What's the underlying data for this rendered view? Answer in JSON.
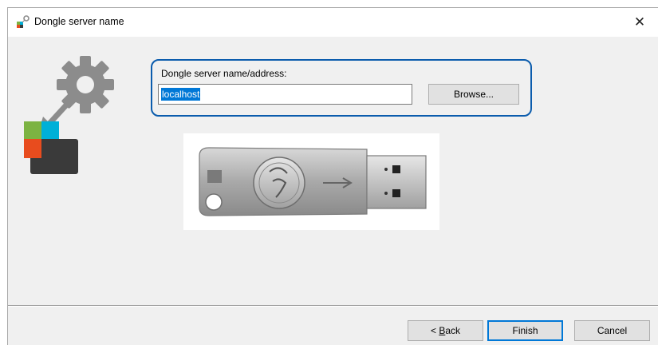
{
  "window": {
    "title": "Dongle server name",
    "close_glyph": "✕"
  },
  "form": {
    "label": "Dongle server name/address:",
    "value": "localhost",
    "browse_label": "Browse..."
  },
  "footer": {
    "back_prefix": "< ",
    "back_accel": "B",
    "back_rest": "ack",
    "finish_label": "Finish",
    "cancel_label": "Cancel"
  },
  "icons": {
    "title": "app-icon",
    "logo": "gear-connect-icon",
    "dongle": "usb-dongle-image"
  },
  "colors": {
    "highlight_border": "#0b5cad",
    "selection": "#0078d7",
    "logo_green": "#7cb342",
    "logo_cyan": "#00b0d8",
    "logo_red": "#e84c1e",
    "logo_dark": "#3a3a3a",
    "gear_gray": "#8c8c8c"
  }
}
